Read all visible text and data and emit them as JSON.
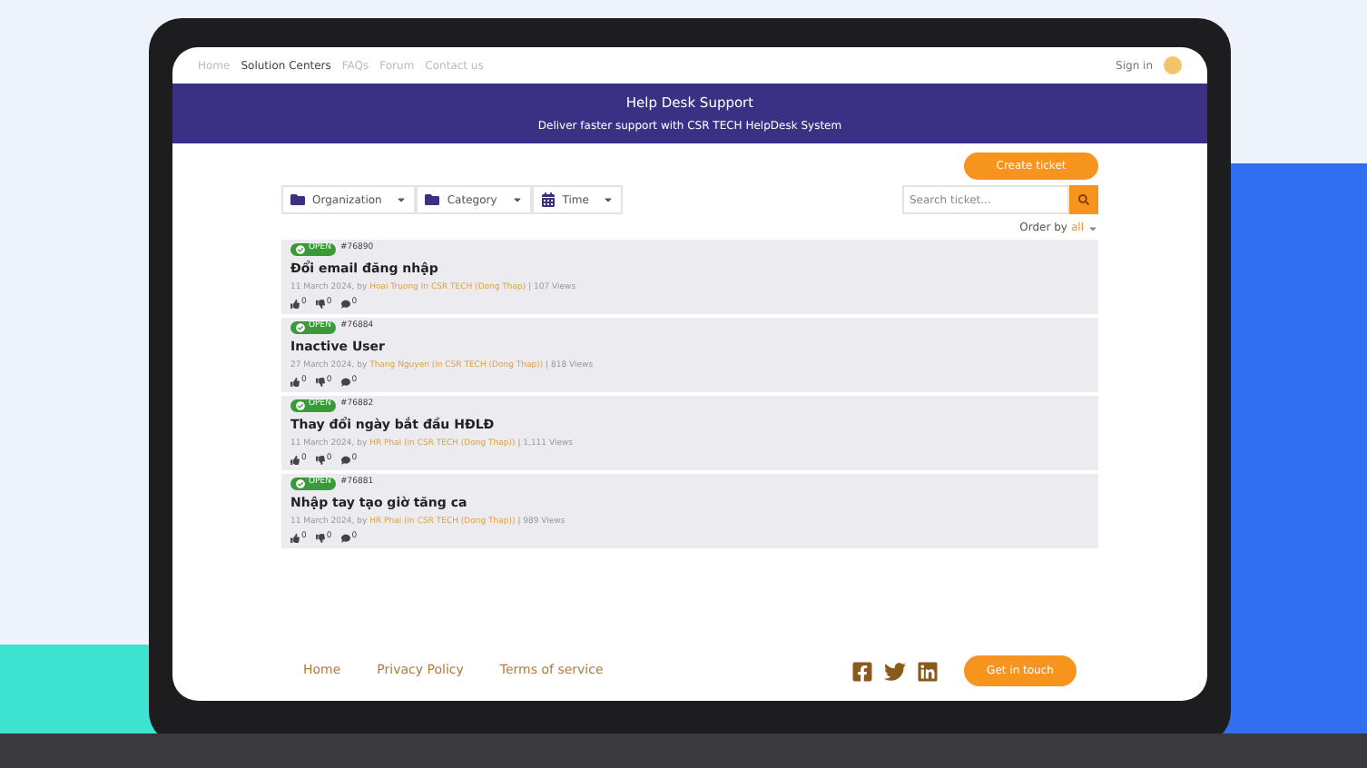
{
  "nav": {
    "links": [
      {
        "label": "Home",
        "selected": false
      },
      {
        "label": "Solution Centers",
        "selected": true
      },
      {
        "label": "FAQs",
        "selected": false
      },
      {
        "label": "Forum",
        "selected": false
      },
      {
        "label": "Contact us",
        "selected": false
      }
    ],
    "signin": "Sign in"
  },
  "banner": {
    "title": "Help Desk Support",
    "subtitle": "Deliver faster support with CSR TECH HelpDesk System"
  },
  "create_button": "Create ticket",
  "filters": [
    {
      "label": "Organization",
      "kind": "folder"
    },
    {
      "label": "Category",
      "kind": "folder"
    },
    {
      "label": "Time",
      "kind": "calendar"
    }
  ],
  "search": {
    "placeholder": "Search ticket..."
  },
  "order": {
    "label": "Order by",
    "value": "all"
  },
  "tickets": [
    {
      "status": "OPEN",
      "number": "#76890",
      "title": "Đổi email đăng nhập",
      "date": "11 March 2024, by",
      "author": "Hoai Truong",
      "org": "In CSR TECH (Dong Thap)",
      "views": "| 107 Views",
      "likes": "0",
      "dislikes": "0",
      "comments": "0"
    },
    {
      "status": "OPEN",
      "number": "#76884",
      "title": "Inactive User",
      "date": "27 March 2024, by",
      "author": "Thang Nguyen",
      "org": "(in CSR TECH (Dong Thap))",
      "views": "| 818 Views",
      "likes": "0",
      "dislikes": "0",
      "comments": "0"
    },
    {
      "status": "OPEN",
      "number": "#76882",
      "title": "Thay đổi ngày bắt đầu HĐLĐ",
      "date": "11 March 2024, by",
      "author": "HR Phai",
      "org": "(in CSR TECH (Dong Thap))",
      "views": "| 1,111 Views",
      "likes": "0",
      "dislikes": "0",
      "comments": "0"
    },
    {
      "status": "OPEN",
      "number": "#76881",
      "title": "Nhập tay tạo giờ tăng ca",
      "date": "11 March 2024, by",
      "author": "HR Phai",
      "org": "(in CSR TECH (Dong Thap))",
      "views": "| 989 Views",
      "likes": "0",
      "dislikes": "0",
      "comments": "0"
    }
  ],
  "footer": {
    "links": [
      "Home",
      "Privacy Policy",
      "Terms of service"
    ],
    "button": "Get in touch"
  }
}
